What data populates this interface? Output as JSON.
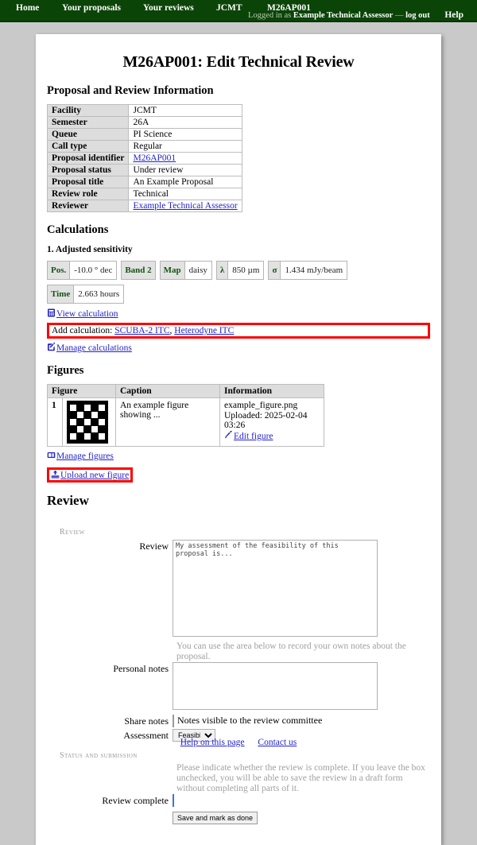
{
  "nav": {
    "home": "Home",
    "proposals": "Your proposals",
    "reviews": "Your reviews",
    "facility": "JCMT",
    "proposal_code": "M26AP001",
    "logged_in_prefix": "Logged in as",
    "user_name": "Example Technical Assessor",
    "logout_separator": "—",
    "logout": "log out",
    "help": "Help"
  },
  "page": {
    "title": "M26AP001: Edit Technical Review"
  },
  "info": {
    "heading": "Proposal and Review Information",
    "rows": [
      {
        "label": "Facility",
        "value": "JCMT",
        "link": false
      },
      {
        "label": "Semester",
        "value": "26A",
        "link": false
      },
      {
        "label": "Queue",
        "value": "PI Science",
        "link": false
      },
      {
        "label": "Call type",
        "value": "Regular",
        "link": false
      },
      {
        "label": "Proposal identifier",
        "value": "M26AP001",
        "link": true
      },
      {
        "label": "Proposal status",
        "value": "Under review",
        "link": false
      },
      {
        "label": "Proposal title",
        "value": "An Example Proposal",
        "link": false
      },
      {
        "label": "Review role",
        "value": "Technical",
        "link": false
      },
      {
        "label": "Reviewer",
        "value": "Example Technical Assessor",
        "link": true
      }
    ]
  },
  "calculations": {
    "heading": "Calculations",
    "item_title": "1. Adjusted sensitivity",
    "badges_row1": [
      {
        "key": "Pos.",
        "value": "-10.0 ° dec"
      },
      {
        "key": "Band 2",
        "value": ""
      },
      {
        "key": "Map",
        "value": "daisy"
      },
      {
        "key": "λ",
        "value": "850 µm"
      },
      {
        "key": "σ",
        "value": "1.434 mJy/beam"
      }
    ],
    "badges_row2": [
      {
        "key": "Time",
        "value": "2.663 hours"
      }
    ],
    "view_link": "View calculation",
    "view_icon": "calculator-icon",
    "add_label": "Add calculation:",
    "add_links": [
      "SCUBA-2 ITC",
      "Heterodyne ITC"
    ],
    "add_separator": ", ",
    "manage_link": "Manage calculations",
    "manage_icon": "edit-square-icon"
  },
  "figures": {
    "heading": "Figures",
    "columns": [
      "Figure",
      "Caption",
      "Information"
    ],
    "rows": [
      {
        "number": "1",
        "thumbnail": "checkerboard-thumbnail",
        "caption": "An example figure showing ...",
        "filename": "example_figure.png",
        "uploaded": "Uploaded: 2025-02-04 03:26",
        "edit_link": "Edit figure",
        "edit_icon": "pencil-icon"
      }
    ],
    "manage_link": "Manage figures",
    "manage_icon": "images-icon",
    "upload_link": "Upload new figure",
    "upload_icon": "upload-icon"
  },
  "review": {
    "heading": "Review",
    "legend_review": "Review",
    "legend_status": "Status and submission",
    "review_label": "Review",
    "review_value": "",
    "review_placeholder": "My assessment of the feasibility of this proposal is...",
    "notes_help": "You can use the area below to record your own notes about the proposal.",
    "notes_label": "Personal notes",
    "notes_value": "",
    "notes_placeholder": "",
    "share_label": "Share notes",
    "share_checkbox_text": "Notes visible to the review committee",
    "share_checked": false,
    "assessment_label": "Assessment",
    "assessment_value": "Feasible",
    "assessment_options": [
      "Feasible"
    ],
    "status_help": "Please indicate whether the review is complete. If you leave the box unchecked, you will be able to save the review in a draft form without completing all parts of it.",
    "complete_label": "Review complete",
    "complete_checked": true,
    "submit_label": "Save and mark as done"
  },
  "footer": {
    "help_link": "Help on this page",
    "contact_link": "Contact us"
  },
  "colors": {
    "nav_background": "#0b4407",
    "page_background": "#c9c9c9",
    "link": "#2222cc",
    "highlight": "#ff0000",
    "badge_key": "#165216",
    "checkbox_checked": "#3b76d8"
  }
}
